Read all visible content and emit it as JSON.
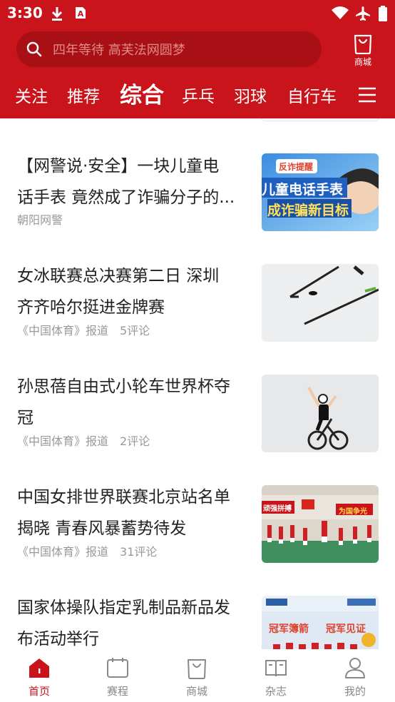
{
  "status_bar": {
    "time": "3:30",
    "icons": [
      "download-icon",
      "notification-a-icon",
      "wifi-icon",
      "airplane-mode-icon",
      "battery-icon"
    ]
  },
  "search": {
    "placeholder": "四年等待 高芙法网圆梦"
  },
  "mall_button": {
    "label": "商城"
  },
  "tabs": [
    {
      "label": "关注"
    },
    {
      "label": "推荐"
    },
    {
      "label": "综合",
      "active": true
    },
    {
      "label": "乒乓"
    },
    {
      "label": "羽球"
    },
    {
      "label": "自行车"
    }
  ],
  "articles": [
    {
      "title_lines": [
        "【网警说·安全】一块儿童电",
        "话手表 竟然成了诈骗分子的..."
      ],
      "source": "朝阳网警",
      "comments": "",
      "thumb_text": [
        "反诈提醒",
        "儿童电话手表",
        "成诈骗新目标"
      ]
    },
    {
      "title_lines": [
        "女冰联赛总决赛第二日 深圳",
        "齐齐哈尔挺进金牌赛"
      ],
      "source": "《中国体育》报道",
      "comments": "5评论"
    },
    {
      "title_lines": [
        "孙思蓓自由式小轮车世界杯夺",
        "冠"
      ],
      "source": "《中国体育》报道",
      "comments": "2评论"
    },
    {
      "title_lines": [
        "中国女排世界联赛北京站名单",
        "揭晓 青春风暴蓄势待发"
      ],
      "source": "《中国体育》报道",
      "comments": "31评论",
      "thumb_text": [
        "顽强拼搏",
        "为国争光"
      ]
    },
    {
      "title_lines": [
        "国家体操队指定乳制品新品发",
        "布活动举行"
      ],
      "source": "",
      "comments": "",
      "thumb_text": [
        "冠军簿箭",
        "冠军见证"
      ]
    }
  ],
  "bottom_nav": [
    {
      "label": "首页",
      "icon": "home-icon",
      "active": true
    },
    {
      "label": "赛程",
      "icon": "calendar-icon"
    },
    {
      "label": "商城",
      "icon": "shopping-bag-icon"
    },
    {
      "label": "杂志",
      "icon": "book-icon"
    },
    {
      "label": "我的",
      "icon": "person-icon"
    }
  ],
  "colors": {
    "brand_red": "#c8141a",
    "search_bg": "#a91016",
    "text_dark": "#222222",
    "text_meta": "#999999",
    "nav_inactive": "#888888"
  }
}
